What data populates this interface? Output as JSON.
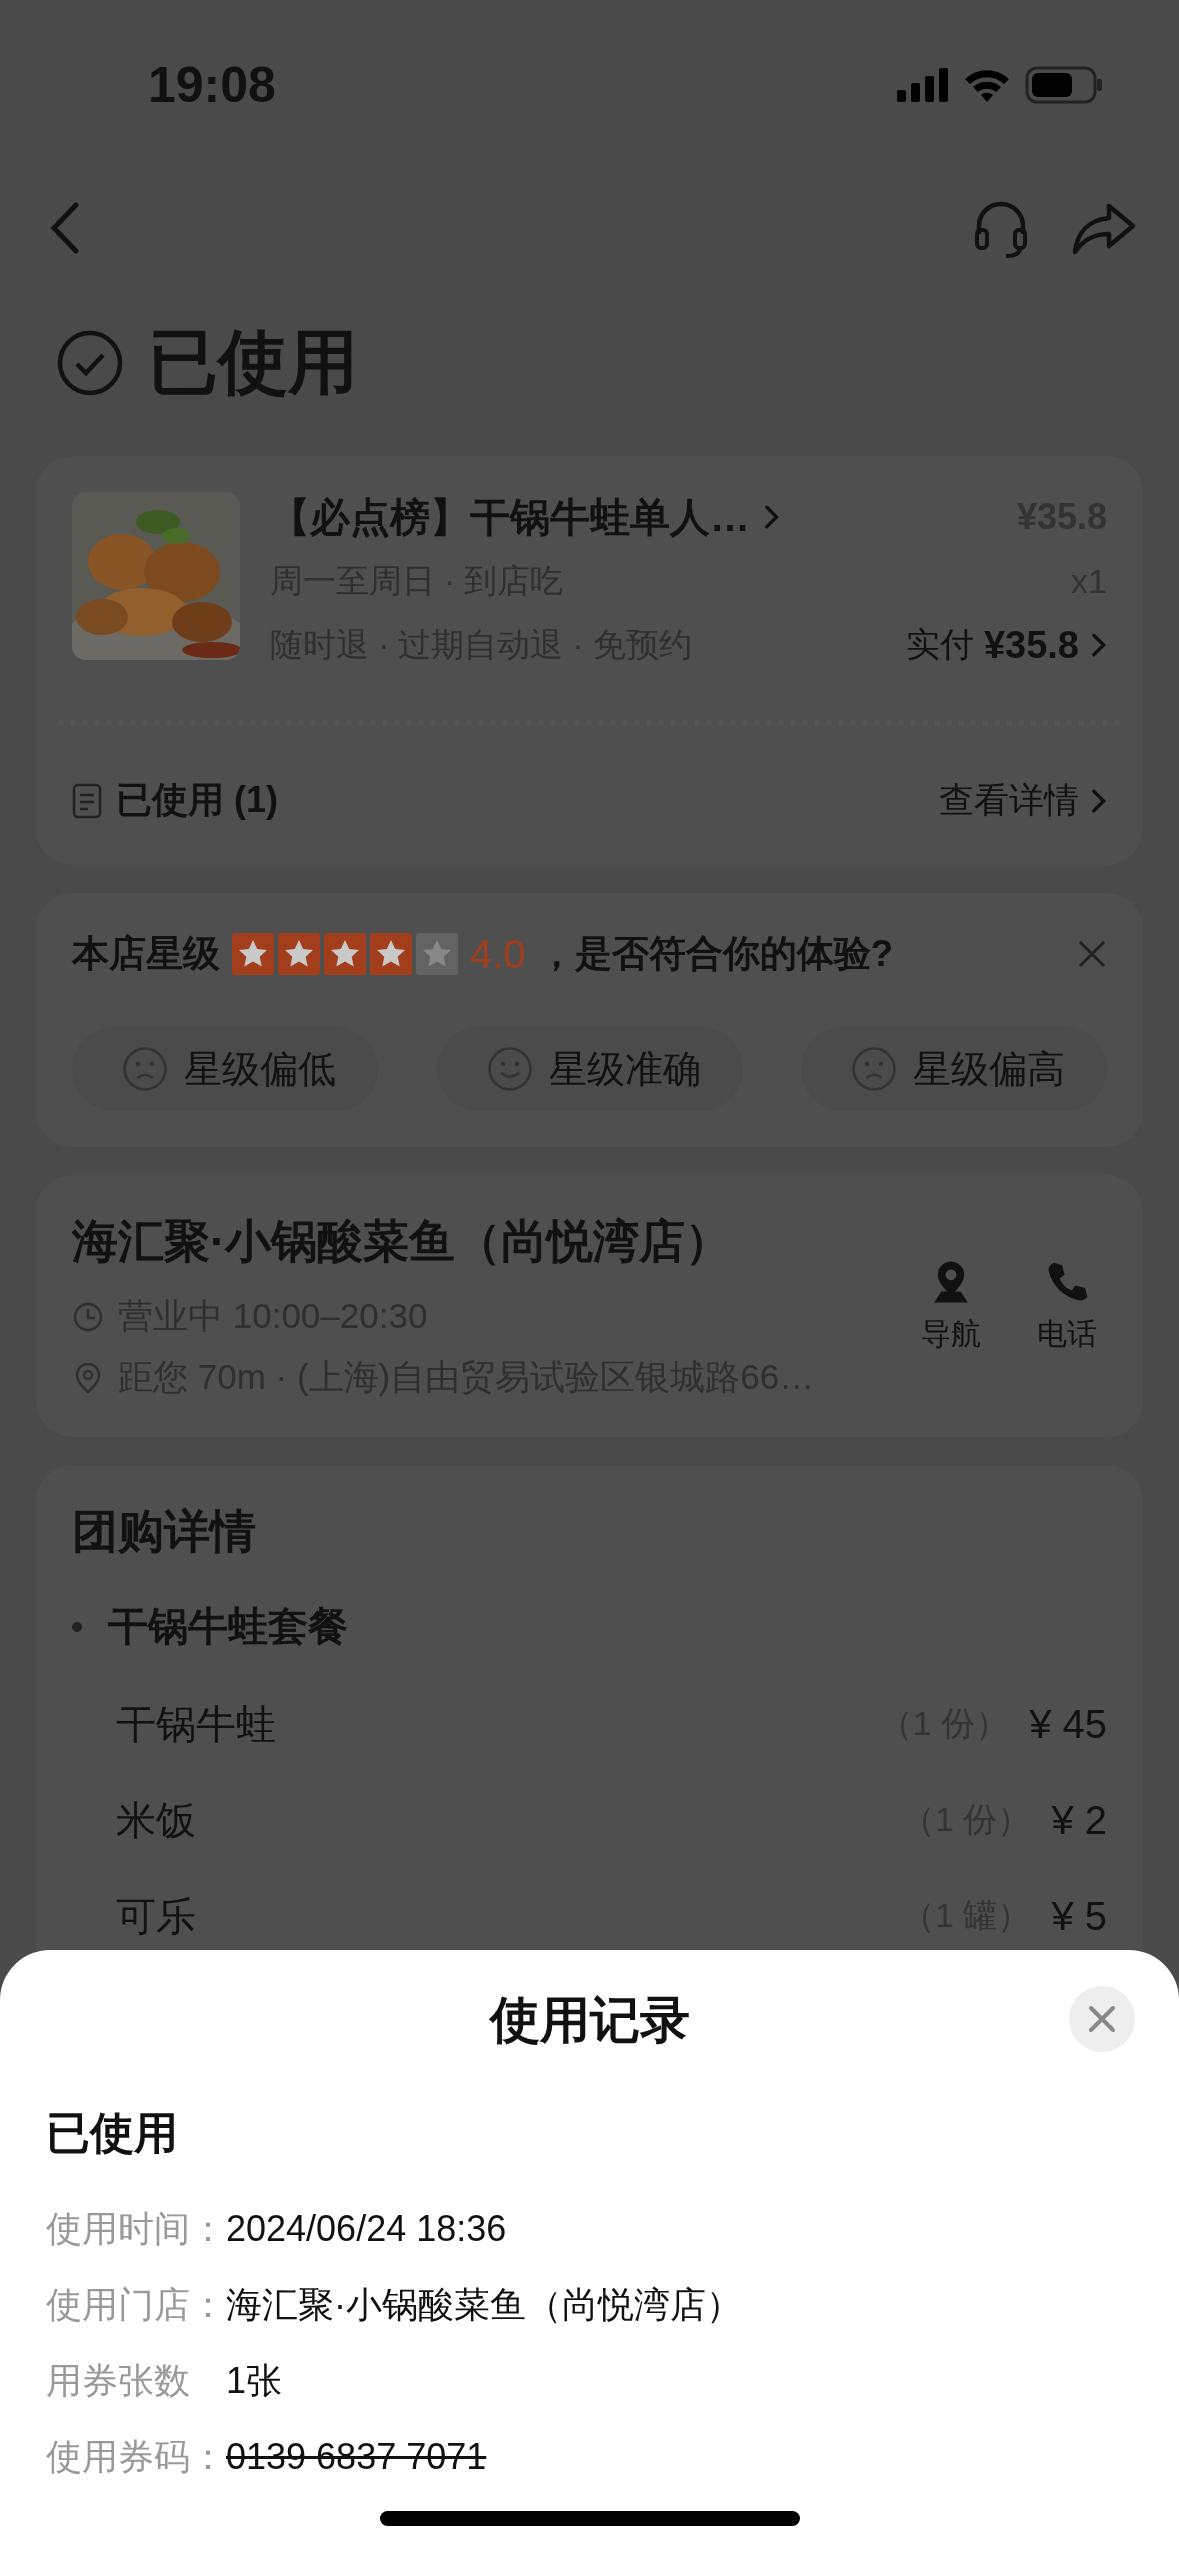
{
  "status_bar": {
    "time": "19:08"
  },
  "header": {
    "title": "已使用"
  },
  "order": {
    "title": "【必点榜】干锅牛蛙单人…",
    "schedule": "周一至周日 · 到店吃",
    "policy": "随时退 · 过期自动退 · 免预约",
    "price": "¥35.8",
    "quantity": "x1",
    "paid_label": "实付",
    "paid_amount": "¥35.8",
    "usage_label": "已使用 (1)",
    "details_link": "查看详情"
  },
  "rating": {
    "label": "本店星级",
    "stars": 4,
    "score": "4.0",
    "question": "，是否符合你的体验?",
    "options": [
      {
        "label": "星级偏低",
        "kind": "sad"
      },
      {
        "label": "星级准确",
        "kind": "happy"
      },
      {
        "label": "星级偏高",
        "kind": "sad"
      }
    ]
  },
  "store": {
    "name": "海汇聚·小锅酸菜鱼（尚悦湾店）",
    "hours": "营业中 10:00–20:30",
    "location": "距您 70m · (上海)自由贸易试验区银城路66…",
    "actions": [
      {
        "label": "导航",
        "kind": "navigate"
      },
      {
        "label": "电话",
        "kind": "phone"
      }
    ]
  },
  "deal": {
    "title": "团购详情",
    "package": "干锅牛蛙套餐",
    "items": [
      {
        "name": "干锅牛蛙",
        "quantity": "（1 份）",
        "price": "¥ 45"
      },
      {
        "name": "米饭",
        "quantity": "（1 份）",
        "price": "¥ 2"
      },
      {
        "name": "可乐",
        "quantity": "（1 罐）",
        "price": "¥ 5"
      }
    ]
  },
  "sheet": {
    "title": "使用记录",
    "status": "已使用",
    "fields": [
      {
        "label": "使用时间：",
        "value": "2024/06/24 18:36",
        "struck": false
      },
      {
        "label": "使用门店：",
        "value": "海汇聚·小锅酸菜鱼（尚悦湾店）",
        "struck": false
      },
      {
        "label": "用券张数",
        "value": "1张",
        "struck": false
      },
      {
        "label": "使用券码：",
        "value": "0139 6837 7071",
        "struck": true
      }
    ]
  }
}
